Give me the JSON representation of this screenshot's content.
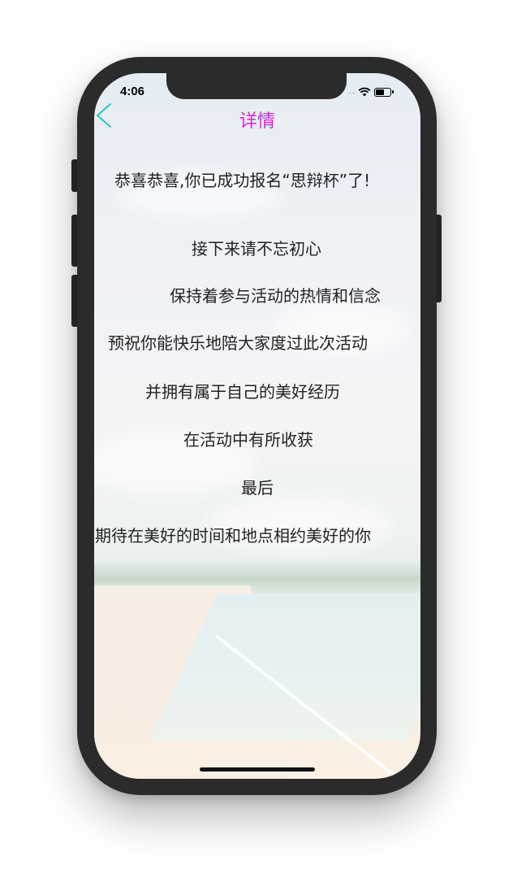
{
  "status_bar": {
    "time": "4:06",
    "signal": "....."
  },
  "nav": {
    "title": "详情",
    "back_icon": "chevron-left-icon"
  },
  "content": {
    "lines": [
      "恭喜恭喜,你已成功报名“思辩杯”了!",
      "接下来请不忘初心",
      "保持着参与活动的热情和信念",
      "预祝你能快乐地陪大家度过此次活动",
      "并拥有属于自己的美好经历",
      "在活动中有所收获",
      "最后",
      "期待在美好的时间和地点相约美好的你"
    ]
  },
  "colors": {
    "title": "#e020d0",
    "back_icon": "#2ec4c4",
    "text": "#222222",
    "frame": "#2b2b2b"
  }
}
